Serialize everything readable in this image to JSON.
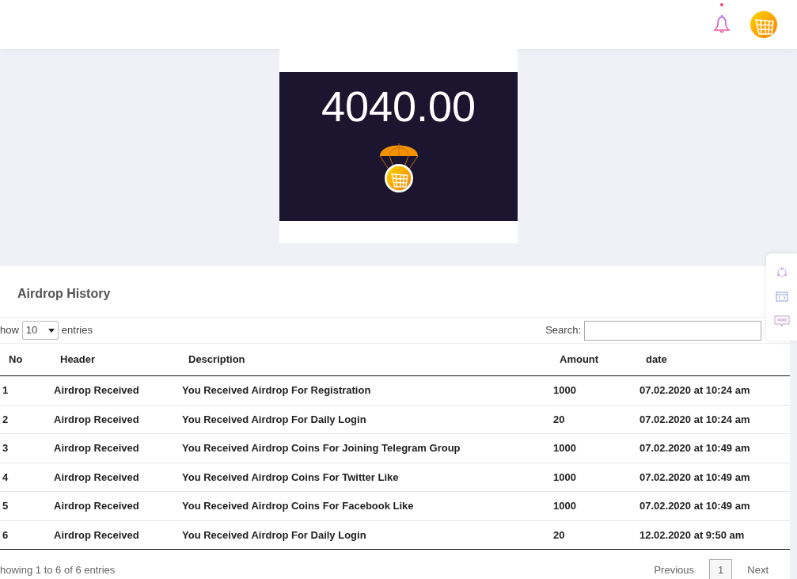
{
  "header": {
    "notification_dot": true
  },
  "balance_card": {
    "amount": "4040.00"
  },
  "history": {
    "title": "Airdrop History",
    "length_control": {
      "prefix": "how",
      "value": "10",
      "suffix": "entries"
    },
    "search": {
      "label": "Search:"
    },
    "columns": [
      "No",
      "Header",
      "Description",
      "Amount",
      "date"
    ],
    "rows": [
      [
        "1",
        "Airdrop Received",
        "You Received Airdrop For Registration",
        "1000",
        "07.02.2020 at 10:24 am"
      ],
      [
        "2",
        "Airdrop Received",
        "You Received Airdrop For Daily Login",
        "20",
        "07.02.2020 at 10:24 am"
      ],
      [
        "3",
        "Airdrop Received",
        "You Received Airdrop Coins For Joining Telegram Group",
        "1000",
        "07.02.2020 at 10:49 am"
      ],
      [
        "4",
        "Airdrop Received",
        "You Received Airdrop Coins For Twitter Like",
        "1000",
        "07.02.2020 at 10:49 am"
      ],
      [
        "5",
        "Airdrop Received",
        "You Received Airdrop Coins For Facebook Like",
        "1000",
        "07.02.2020 at 10:49 am"
      ],
      [
        "6",
        "Airdrop Received",
        "You Received Airdrop For Daily Login",
        "20",
        "12.02.2020 at 9:50 am"
      ]
    ],
    "info": "howing 1 to 6 of 6 entries",
    "pagination": [
      {
        "label": "Previous",
        "selected": false
      },
      {
        "label": "1",
        "selected": true
      },
      {
        "label": "Next",
        "selected": false
      }
    ]
  }
}
